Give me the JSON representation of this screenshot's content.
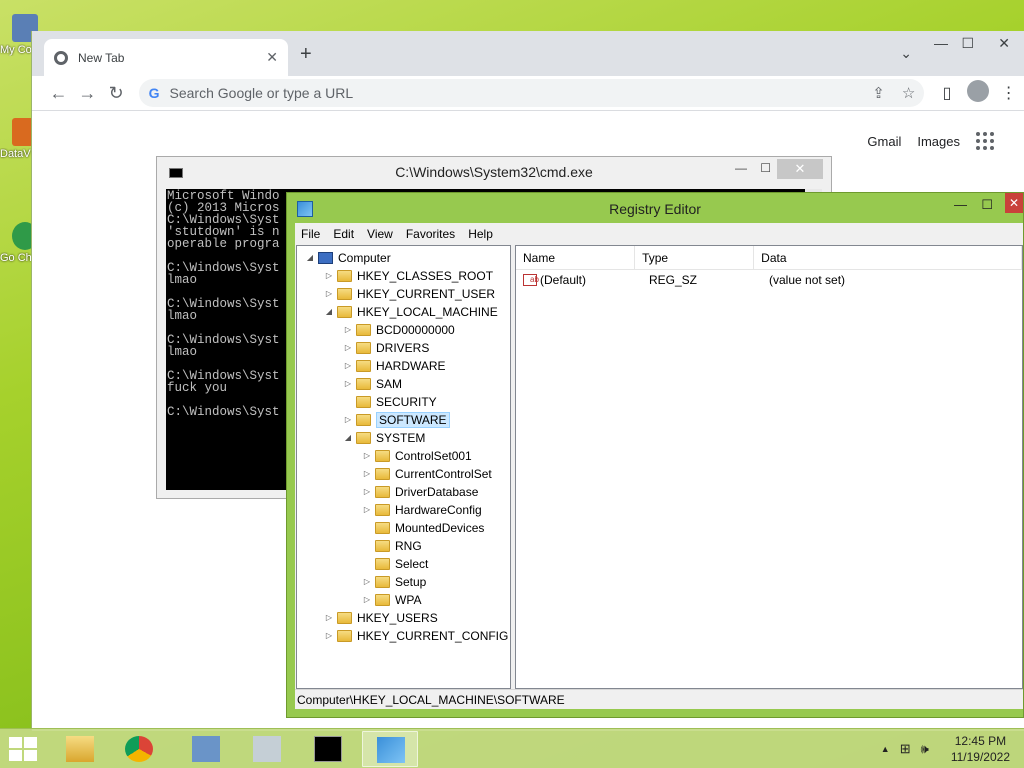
{
  "desktop": {
    "icons": [
      {
        "label": "My Co",
        "color": "#5a7fb5"
      },
      {
        "label": "DataV",
        "color": "#d96a1f"
      },
      {
        "label": "Go Ch",
        "color": "#2f9a48"
      }
    ]
  },
  "chrome": {
    "tab_title": "New Tab",
    "tab_close": "✕",
    "new_tab": "+",
    "omnibox_placeholder": "Search Google or type a URL",
    "omnibox_g": "G",
    "links": {
      "gmail": "Gmail",
      "images": "Images"
    },
    "controls": {
      "dropdown": "⌄",
      "minimize": "—",
      "maximize": "☐",
      "close": "✕"
    },
    "toolbar": {
      "back": "←",
      "forward": "→",
      "reload": "↻",
      "share": "⇪",
      "star": "☆",
      "sidepanel": "▯",
      "menu": "⋮"
    }
  },
  "cmd": {
    "title": "C:\\Windows\\System32\\cmd.exe",
    "minimize": "—",
    "maximize": "☐",
    "close": "✕",
    "lines": [
      "Microsoft Windo",
      "(c) 2013 Micros",
      "C:\\Windows\\Syst",
      "'stutdown' is n",
      "operable progra",
      "",
      "C:\\Windows\\Syst",
      "lmao",
      "",
      "C:\\Windows\\Syst",
      "lmao",
      "",
      "C:\\Windows\\Syst",
      "lmao",
      "",
      "C:\\Windows\\Syst",
      "fuck you",
      "",
      "C:\\Windows\\Syst"
    ]
  },
  "registry": {
    "title": "Registry Editor",
    "minimize": "—",
    "maximize": "☐",
    "close": "✕",
    "menu": [
      "File",
      "Edit",
      "View",
      "Favorites",
      "Help"
    ],
    "tree": {
      "computer": "Computer",
      "hkcr": "HKEY_CLASSES_ROOT",
      "hkcu": "HKEY_CURRENT_USER",
      "hklm": "HKEY_LOCAL_MACHINE",
      "hklm_children": [
        "BCD00000000",
        "DRIVERS",
        "HARDWARE",
        "SAM",
        "SECURITY",
        "SOFTWARE",
        "SYSTEM"
      ],
      "system_children": [
        "ControlSet001",
        "CurrentControlSet",
        "DriverDatabase",
        "HardwareConfig",
        "MountedDevices",
        "RNG",
        "Select",
        "Setup",
        "WPA"
      ],
      "hku": "HKEY_USERS",
      "hkcc": "HKEY_CURRENT_CONFIG",
      "selected": "SOFTWARE"
    },
    "columns": {
      "name": "Name",
      "type": "Type",
      "data": "Data"
    },
    "values": [
      {
        "icon": "ab",
        "name": "(Default)",
        "type": "REG_SZ",
        "data": "(value not set)"
      }
    ],
    "status": "Computer\\HKEY_LOCAL_MACHINE\\SOFTWARE"
  },
  "taskbar": {
    "tray": {
      "arrow": "▲",
      "network": "⊞",
      "volume": "🕪"
    },
    "time": "12:45 PM",
    "date": "11/19/2022"
  }
}
